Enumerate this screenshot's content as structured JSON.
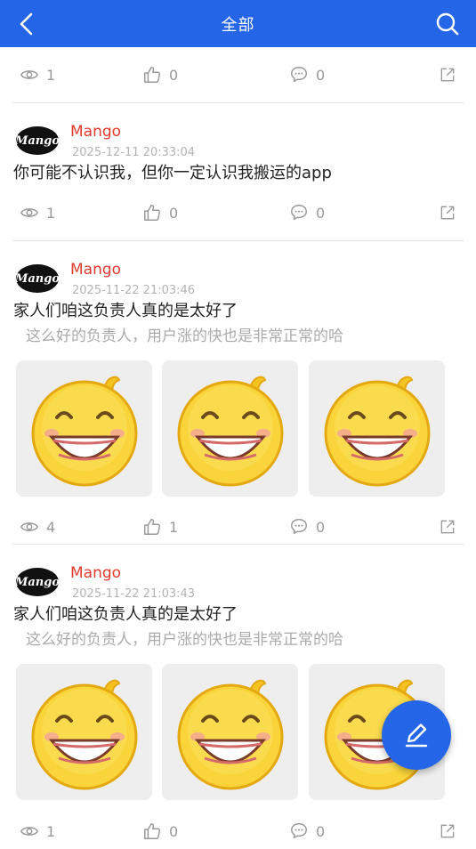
{
  "header": {
    "title": "全部"
  },
  "colors": {
    "brand": "#2566e8",
    "author": "#e23a2e"
  },
  "first_stats": {
    "views": "1",
    "likes": "0",
    "comments": "0"
  },
  "posts": [
    {
      "author": "Mango",
      "avatar_text": "Mango",
      "time": "2025-12-11 20:33:04",
      "content": "你可能不认识我，但你一定认识我搬运的app",
      "stats": {
        "views": "1",
        "likes": "0",
        "comments": "0"
      }
    },
    {
      "author": "Mango",
      "avatar_text": "Mango",
      "time": "2025-11-22 21:03:46",
      "content": "家人们咱这负责人真的是太好了",
      "subtext": "这么好的负责人，用户涨的快也是非常正常的哈",
      "images": [
        "grinning-emoji",
        "grinning-emoji",
        "grinning-emoji"
      ],
      "stats": {
        "views": "4",
        "likes": "1",
        "comments": "0"
      }
    },
    {
      "author": "Mango",
      "avatar_text": "Mango",
      "time": "2025-11-22 21:03:43",
      "content": "家人们咱这负责人真的是太好了",
      "subtext": "这么好的负责人，用户涨的快也是非常正常的哈",
      "images": [
        "grinning-emoji",
        "grinning-emoji",
        "grinning-emoji"
      ],
      "stats": {
        "views": "1",
        "likes": "0",
        "comments": "0"
      }
    }
  ],
  "icons": [
    "back-arrow-icon",
    "search-icon",
    "eye-icon",
    "thumb-up-icon",
    "comment-icon",
    "share-icon",
    "edit-pen-icon"
  ]
}
